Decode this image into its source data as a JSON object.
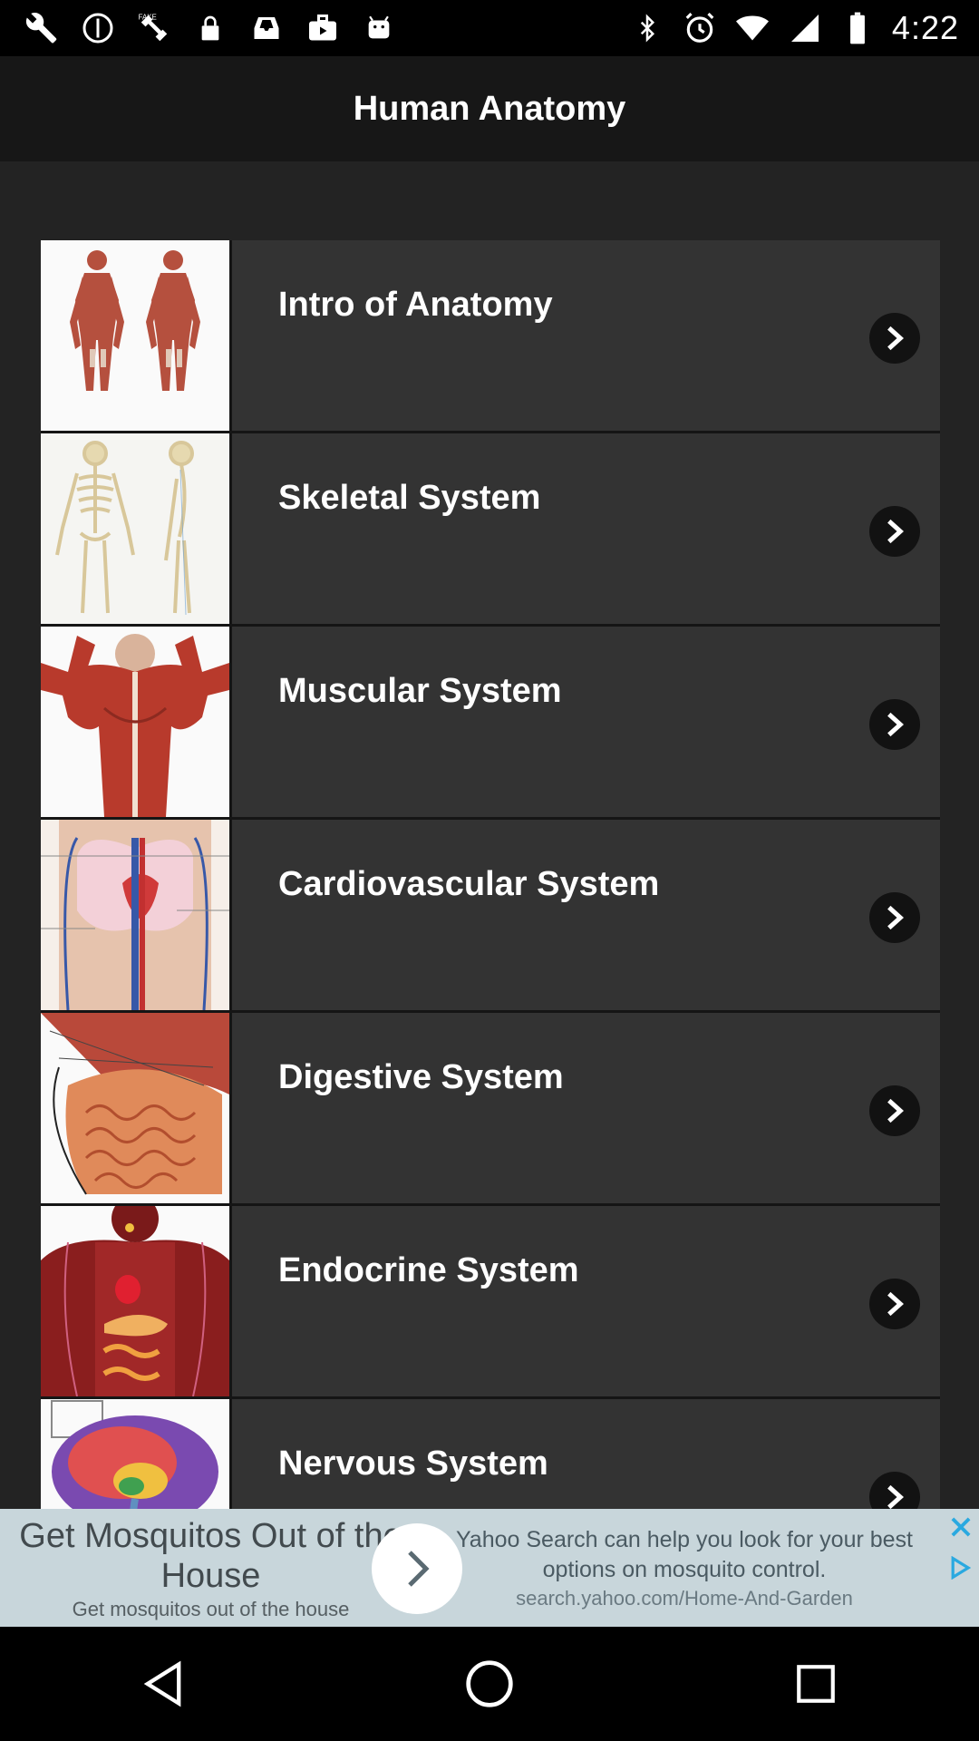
{
  "status_bar": {
    "time": "4:22",
    "left_icons": [
      "wrench-icon",
      "sync-icon",
      "fake-gps-icon",
      "lock-icon",
      "inbox-icon",
      "briefcase-icon",
      "android-icon"
    ],
    "right_icons": [
      "bluetooth-icon",
      "alarm-icon",
      "wifi-icon",
      "signal-icon",
      "battery-icon"
    ]
  },
  "header": {
    "title": "Human Anatomy"
  },
  "topics": [
    {
      "label": "Intro of Anatomy"
    },
    {
      "label": "Skeletal System"
    },
    {
      "label": "Muscular System"
    },
    {
      "label": "Cardiovascular System"
    },
    {
      "label": "Digestive System"
    },
    {
      "label": "Endocrine System"
    },
    {
      "label": "Nervous System"
    }
  ],
  "ad": {
    "title": "Get Mosquitos Out of the House",
    "subtitle": "Get mosquitos out of the house",
    "description": "Yahoo Search can help you look for your best options on mosquito control.",
    "url": "search.yahoo.com/Home-And-Garden"
  },
  "colors": {
    "background": "#232323",
    "list_item": "#333333",
    "header": "#171717",
    "ad_background": "#c8d6db",
    "ad_close": "#2aa9e0"
  }
}
